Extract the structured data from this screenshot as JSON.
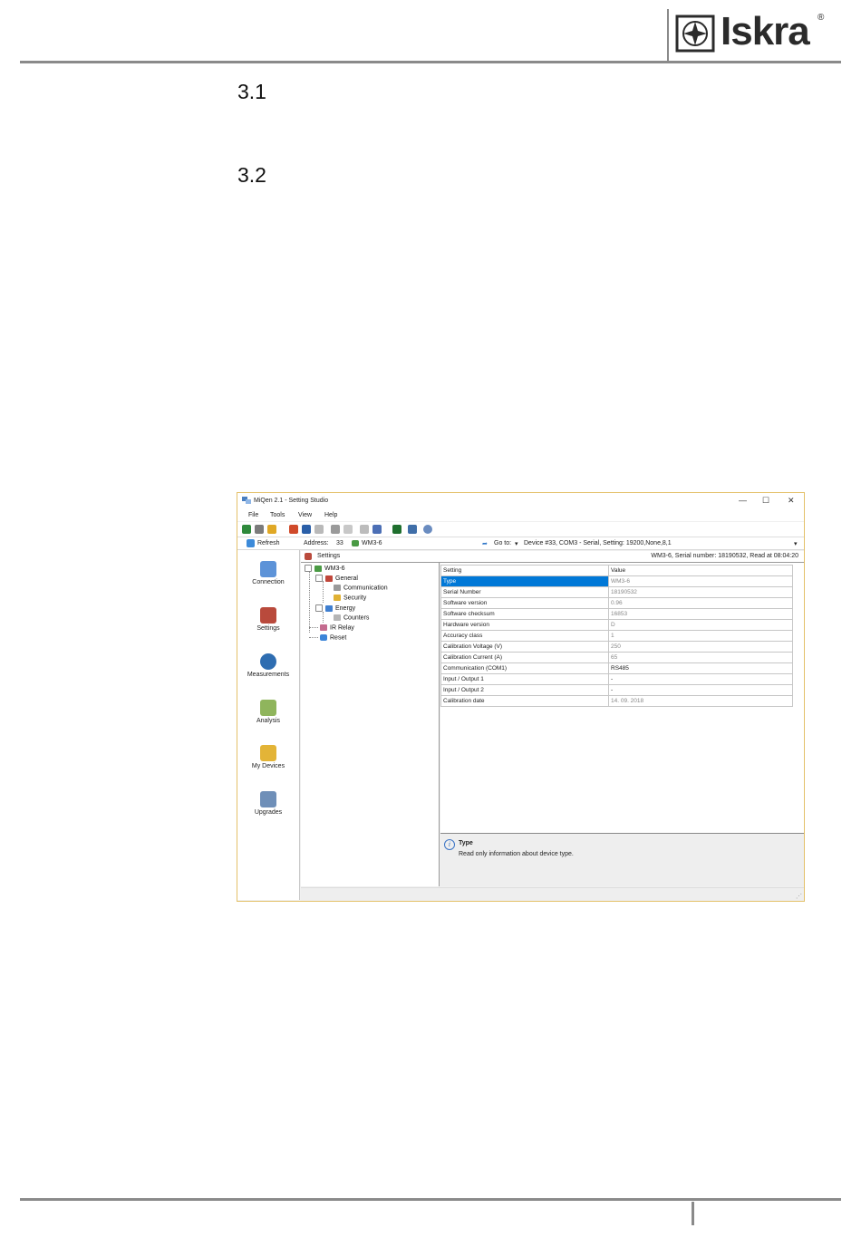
{
  "header": {
    "brand": "Iskra",
    "registered": "®"
  },
  "sections": {
    "s1": "3.1",
    "s2": "3.2"
  },
  "window": {
    "title": "MiQen 2.1 - Setting Studio",
    "controls": {
      "minimize": "—",
      "maximize": "☐",
      "close": "✕"
    },
    "menu": [
      "File",
      "Tools",
      "View",
      "Help"
    ],
    "address_bar": {
      "refresh": "Refresh",
      "address_label": "Address:",
      "address_value": "33",
      "device": "WM3-6",
      "goto_label": "Go to:",
      "goto_value": "Device #33, COM3 - Serial, Setting: 19200,None,8,1"
    },
    "nav": [
      "Connection",
      "Settings",
      "Measurements",
      "Analysis",
      "My Devices",
      "Upgrades"
    ],
    "settings_header": {
      "title": "Settings",
      "device_info": "WM3-6, Serial number: 18190532, Read at 08:04:20"
    },
    "tree": {
      "root": "WM3-6",
      "general": "General",
      "communication": "Communication",
      "security": "Security",
      "energy": "Energy",
      "counters": "Counters",
      "ir_relay": "IR Relay",
      "reset": "Reset"
    },
    "grid": {
      "headers": [
        "Setting",
        "Value"
      ],
      "rows": [
        [
          "Type",
          "WM3-6"
        ],
        [
          "Serial Number",
          "18190532"
        ],
        [
          "Software version",
          "0.96"
        ],
        [
          "Software checksum",
          "16853"
        ],
        [
          "Hardware version",
          "D"
        ],
        [
          "Accuracy class",
          "1"
        ],
        [
          "Calibration Voltage (V)",
          "250"
        ],
        [
          "Calibration Current (A)",
          "65"
        ],
        [
          "Communication (COM1)",
          "RS485"
        ],
        [
          "Input / Output 1",
          "-"
        ],
        [
          "Input / Output 2",
          "-"
        ],
        [
          "Calibration date",
          "14. 09. 2018"
        ]
      ]
    },
    "info": {
      "title": "Type",
      "text": "Read only information about device type."
    },
    "colors": {
      "accent": "#0078d7",
      "frame": "#e4c16a"
    }
  }
}
